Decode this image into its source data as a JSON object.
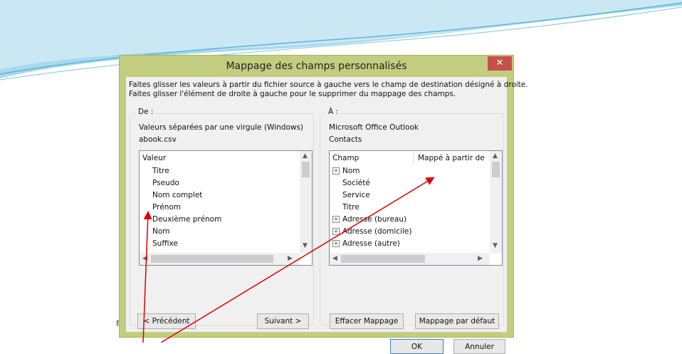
{
  "dialog": {
    "title": "Mappage des champs personnalisés",
    "close_glyph": "✕",
    "instructions_line1": "Faites glisser les valeurs à partir du fichier source à gauche vers le champ de destination désigné à droite.",
    "instructions_line2": "Faites glisser l'élément de droite à gauche pour le supprimer du mappage des champs."
  },
  "from": {
    "label": "De :",
    "source_type": "Valeurs séparées par une virgule (Windows)",
    "file_name": "abook.csv",
    "column_header": "Valeur",
    "items": [
      "Titre",
      "Pseudo",
      "Nom complet",
      "Prénom",
      "Deuxième prénom",
      "Nom",
      "Suffixe"
    ]
  },
  "to": {
    "label": "À :",
    "destination_app": "Microsoft Office Outlook",
    "destination_folder": "Contacts",
    "column_field": "Champ",
    "column_mapped": "Mappé à partir de",
    "items": [
      {
        "label": "Nom",
        "expandable": true
      },
      {
        "label": "Société",
        "expandable": false
      },
      {
        "label": "Service",
        "expandable": false
      },
      {
        "label": "Titre",
        "expandable": false
      },
      {
        "label": "Adresse (bureau)",
        "expandable": true
      },
      {
        "label": "Adresse (domicile)",
        "expandable": true
      },
      {
        "label": "Adresse (autre)",
        "expandable": true
      }
    ]
  },
  "buttons": {
    "previous": "< Précédent",
    "next": "Suivant >",
    "clear_mapping": "Effacer Mappage",
    "default_mapping": "Mappage par défaut",
    "ok": "OK",
    "cancel": "Annuler"
  },
  "icons": {
    "expand": "plus-box-icon",
    "scroll_up": "chevron-up-icon",
    "scroll_down": "chevron-down-icon",
    "scroll_left": "chevron-left-icon",
    "scroll_right": "chevron-right-icon",
    "close": "close-icon"
  },
  "colors": {
    "dialog_frame": "#c2cd7f",
    "close_button": "#c7504a",
    "annotation_arrow": "#e00000",
    "slide_swoosh": "#9ed4ea"
  },
  "slide": {
    "partial_text": "E"
  }
}
